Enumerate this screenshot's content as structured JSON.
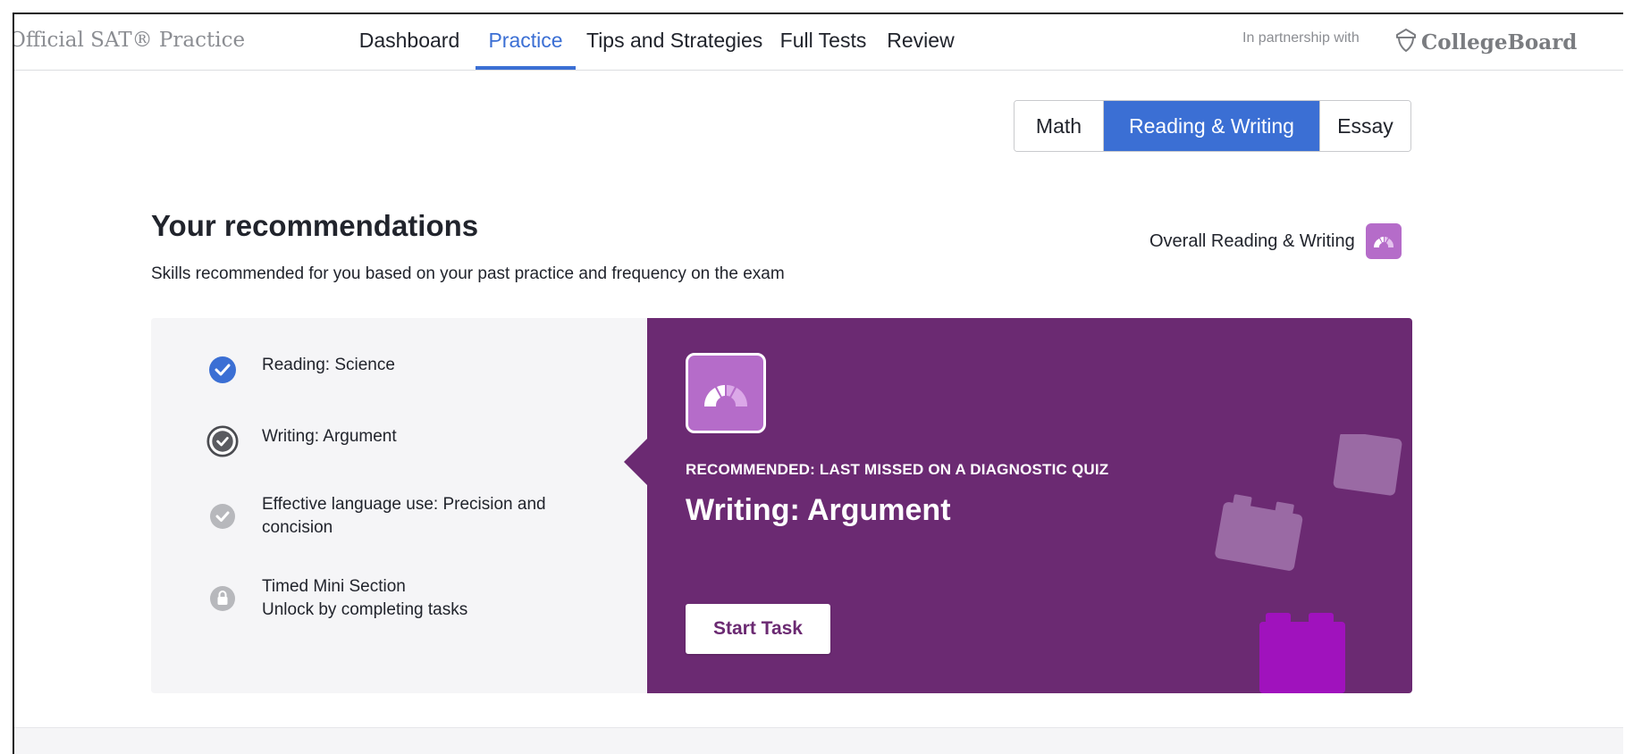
{
  "header": {
    "brand": "Official SAT® Practice",
    "nav": [
      {
        "label": "Dashboard",
        "active": false
      },
      {
        "label": "Practice",
        "active": true
      },
      {
        "label": "Tips and Strategies",
        "active": false
      },
      {
        "label": "Full Tests",
        "active": false
      },
      {
        "label": "Review",
        "active": false
      }
    ],
    "partner_text": "In partnership with",
    "partner_logo_text": "CollegeBoard",
    "accent_color": "#3b6fd4"
  },
  "subject_tabs": [
    {
      "label": "Math",
      "active": false
    },
    {
      "label": "Reading & Writing",
      "active": true
    },
    {
      "label": "Essay",
      "active": false
    }
  ],
  "recommendations": {
    "title": "Your recommendations",
    "subtitle": "Skills recommended for you based on your past practice and frequency on the exam",
    "overall_label": "Overall Reading & Writing",
    "tasks": [
      {
        "label": "Reading: Science",
        "status": "completed",
        "icon": "check-circle-blue-icon"
      },
      {
        "label": "Writing: Argument",
        "status": "selected",
        "icon": "check-circle-dark-icon"
      },
      {
        "label": "Effective language use: Precision and concision",
        "status": "pending",
        "icon": "check-circle-gray-icon"
      },
      {
        "label": "Timed Mini Section",
        "sublabel": "Unlock by completing tasks",
        "status": "locked",
        "icon": "lock-icon"
      }
    ],
    "selected": {
      "kicker": "RECOMMENDED: LAST MISSED ON A DIAGNOSTIC QUIZ",
      "skill": "Writing: Argument",
      "button": "Start Task",
      "panel_color": "#6b2a72",
      "badge_color": "#b56cc9"
    }
  }
}
